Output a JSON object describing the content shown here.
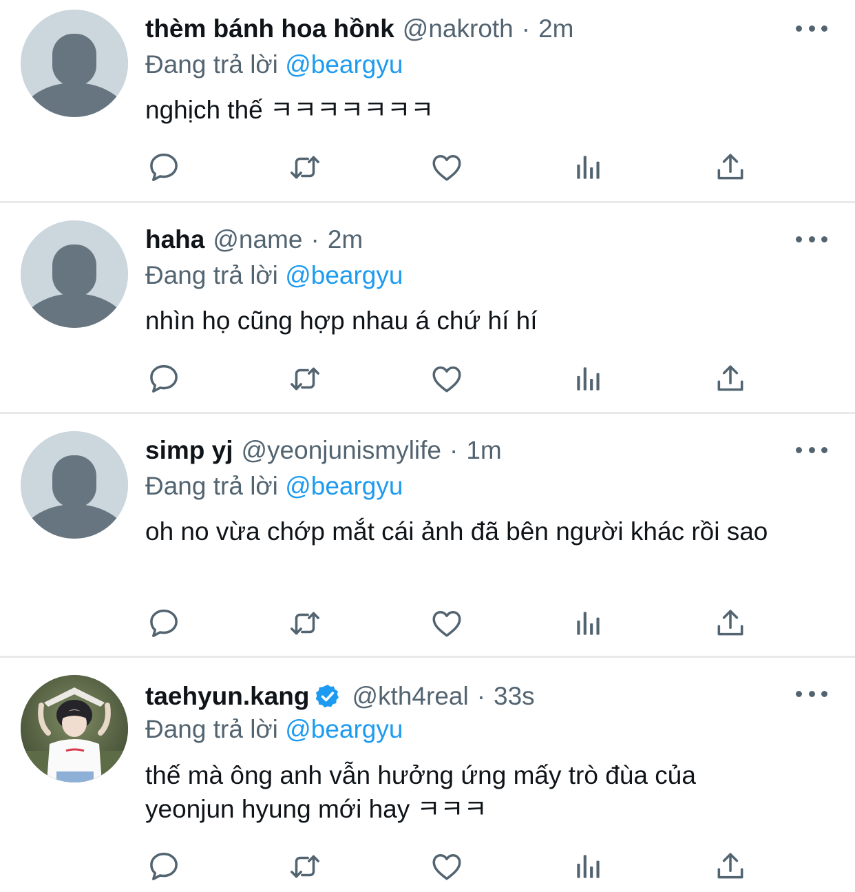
{
  "theme": {
    "text_primary": "#0f1419",
    "text_secondary": "#536471",
    "accent": "#1d9bf0",
    "divider": "#e7e9ea",
    "avatar_placeholder_bg": "#ccd6dd",
    "avatar_placeholder_fg": "#66757f"
  },
  "tweets": [
    {
      "display_name": "thèm bánh hoa hồnk",
      "handle": "@nakroth",
      "separator": "·",
      "time": "2m",
      "replying_prefix": "Đang trả lời",
      "replying_to": "@beargyu",
      "text": "nghịch thế ㅋㅋㅋㅋㅋㅋㅋ",
      "verified": false,
      "avatar": "default-avatar-icon"
    },
    {
      "display_name": "haha",
      "handle": "@name",
      "separator": "·",
      "time": "2m",
      "replying_prefix": "Đang trả lời",
      "replying_to": "@beargyu",
      "text": "nhìn họ cũng hợp nhau á chứ hí hí",
      "verified": false,
      "avatar": "default-avatar-icon"
    },
    {
      "display_name": "simp yj",
      "handle": "@yeonjunismylife",
      "separator": "·",
      "time": "1m",
      "replying_prefix": "Đang trả lời",
      "replying_to": "@beargyu",
      "text": "oh no vừa chớp mắt cái ảnh đã bên người khác rồi sao",
      "verified": false,
      "avatar": "default-avatar-icon"
    },
    {
      "display_name": "taehyun.kang",
      "handle": "@kth4real",
      "separator": "·",
      "time": "33s",
      "replying_prefix": "Đang trả lời",
      "replying_to": "@beargyu",
      "text": "thế mà ông anh vẫn hưởng ứng mấy trò đùa của yeonjun hyung mới hay ㅋㅋㅋ",
      "verified": true,
      "avatar": "profile-photo"
    }
  ],
  "action_icons": [
    "reply-icon",
    "retweet-icon",
    "like-icon",
    "analytics-icon",
    "share-icon"
  ],
  "more_icon": "more-options-icon"
}
